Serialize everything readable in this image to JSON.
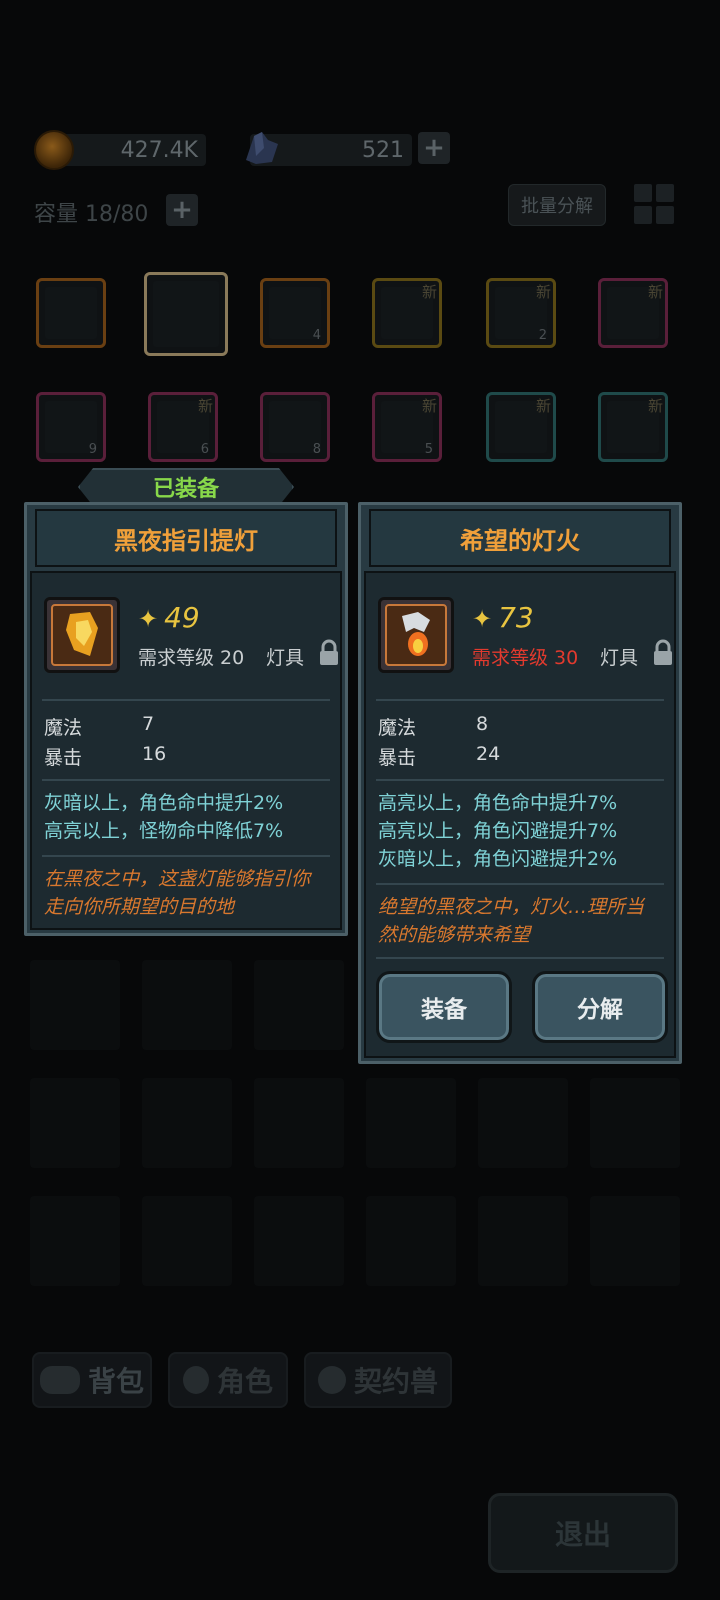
{
  "currency": {
    "gold": "427.4K",
    "crystal": "521"
  },
  "inventory": {
    "capacity": "容量 18/80",
    "bulk_button": "批量分解",
    "row1": [
      {
        "border": "#6a3f12",
        "count": "",
        "new": ""
      },
      {
        "border": "#7a5a2a",
        "count": "",
        "new": ""
      },
      {
        "border": "#6a3f12",
        "count": "4",
        "new": ""
      },
      {
        "border": "#5a4a12",
        "count": "",
        "new": "新"
      },
      {
        "border": "#5a4a12",
        "count": "2",
        "new": "新"
      },
      {
        "border": "#5a1f3a",
        "count": "",
        "new": "新"
      }
    ],
    "row2": [
      {
        "border": "#5a1f3a",
        "count": "9",
        "new": ""
      },
      {
        "border": "#5a1f3a",
        "count": "6",
        "new": "新"
      },
      {
        "border": "#5a1f3a",
        "count": "8",
        "new": ""
      },
      {
        "border": "#5a1f3a",
        "count": "5",
        "new": "新"
      },
      {
        "border": "#1f4a4a",
        "count": "",
        "new": "新"
      },
      {
        "border": "#1f4a4a",
        "count": "",
        "new": "新"
      }
    ]
  },
  "equipped_tab": "已装备",
  "left_panel": {
    "title": "黑夜指引提灯",
    "power": "49",
    "requirement": "需求等级 20",
    "type": "灯具",
    "stats": [
      {
        "name": "魔法",
        "value": "7"
      },
      {
        "name": "暴击",
        "value": "16"
      }
    ],
    "effects": [
      "灰暗以上，角色命中提升2%",
      "高亮以上，怪物命中降低7%"
    ],
    "description": [
      "在黑夜之中，这盏灯能够指引你",
      "走向你所期望的目的地"
    ]
  },
  "right_panel": {
    "title": "希望的灯火",
    "power": "73",
    "requirement": "需求等级 30",
    "type": "灯具",
    "stats": [
      {
        "name": "魔法",
        "value": "8"
      },
      {
        "name": "暴击",
        "value": "24"
      }
    ],
    "effects": [
      "高亮以上，角色命中提升7%",
      "高亮以上，角色闪避提升7%",
      "灰暗以上，角色闪避提升2%"
    ],
    "description": [
      "绝望的黑夜之中，灯火…理所当",
      "然的能够带来希望"
    ],
    "equip_button": "装备",
    "decompose_button": "分解"
  },
  "bottom_tabs": {
    "bag": "背包",
    "character": "角色",
    "pet": "契约兽"
  },
  "exit_button": "退出",
  "colors": {
    "title_orange": "#f0a03a",
    "effect_cyan": "#7fd2d6",
    "desc_orange": "#d9782e",
    "power_gold": "#e8c440",
    "req_red": "#e23a2e",
    "equipped_green": "#88d84a"
  }
}
